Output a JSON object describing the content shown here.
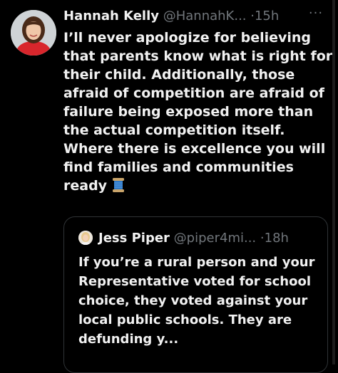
{
  "tweet": {
    "author_name": "Hannah Kelly",
    "author_handle": "@HannahK...",
    "separator": "·",
    "time": "15h",
    "more_label": "···",
    "text": "I’ll never apologize for believing that parents know what is right for their child. Additionally, those afraid of competition are afraid of failure being exposed more than the actual competition itself. Where there is excellence you will find families and communities ready",
    "emoji": "spool-of-thread-emoji"
  },
  "quoted": {
    "author_name": "Jess Piper",
    "author_handle": "@piper4mi...",
    "separator": "·",
    "time": "18h",
    "text": "If you’re a rural person and your Representative voted for school choice, they voted against your local public schools. They are defunding y..."
  },
  "colors": {
    "background": "#000000",
    "text": "#e7e9ea",
    "secondary": "#71767b",
    "border": "#2f3336"
  }
}
